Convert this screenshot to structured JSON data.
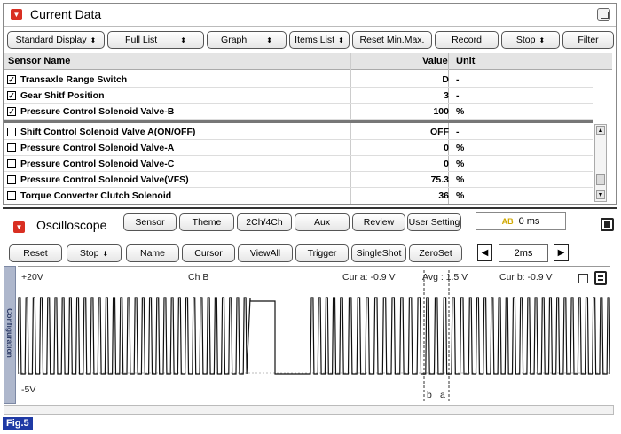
{
  "current_data": {
    "title": "Current Data",
    "toolbar": {
      "standard_display": "Standard Display",
      "full_list": "Full List",
      "graph": "Graph",
      "items_list": "Items List",
      "reset_min_max": "Reset Min.Max.",
      "record": "Record",
      "stop": "Stop",
      "filter": "Filter"
    },
    "columns": {
      "sensor_name": "Sensor Name",
      "value": "Value",
      "unit": "Unit"
    },
    "rows": [
      {
        "checked": true,
        "check_mark": "✓",
        "name": "Transaxle Range Switch",
        "value": "D",
        "unit": "-"
      },
      {
        "checked": true,
        "check_mark": "✓",
        "name": "Gear Shitf Position",
        "value": "3",
        "unit": "-"
      },
      {
        "checked": true,
        "check_mark": "✓",
        "name": "Pressure Control Solenoid Valve-B",
        "value": "100",
        "unit": "%"
      },
      {
        "checked": false,
        "check_mark": "",
        "name": "Shift Control Solenoid Valve A(ON/OFF)",
        "value": "OFF",
        "unit": "-"
      },
      {
        "checked": false,
        "check_mark": "",
        "name": "Pressure Control Solenoid Valve-A",
        "value": "0",
        "unit": "%"
      },
      {
        "checked": false,
        "check_mark": "",
        "name": "Pressure Control Solenoid Valve-C",
        "value": "0",
        "unit": "%"
      },
      {
        "checked": false,
        "check_mark": "",
        "name": "Pressure Control Solenoid Valve(VFS)",
        "value": "75.3",
        "unit": "%"
      },
      {
        "checked": false,
        "check_mark": "",
        "name": "Torque Converter Clutch Solenoid",
        "value": "36",
        "unit": "%"
      }
    ]
  },
  "oscilloscope": {
    "title": "Oscilloscope",
    "top_buttons": {
      "sensor": "Sensor",
      "theme": "Theme",
      "channels": "2Ch/4Ch",
      "aux": "Aux",
      "review": "Review",
      "user_setting": "User Setting"
    },
    "time_readout": "0 ms",
    "time_icon_text": "AB",
    "bottom_buttons": {
      "reset": "Reset",
      "stop": "Stop",
      "name": "Name",
      "cursor": "Cursor",
      "view_all": "ViewAll",
      "trigger": "Trigger",
      "single_shot": "SingleShot",
      "zero_set": "ZeroSet"
    },
    "timebase": "2ms",
    "config_tab": "Configuration",
    "plot": {
      "top_voltage": "+20V",
      "bottom_voltage": "-5V",
      "channel": "Ch B",
      "cur_a": "Cur a: -0.9 V",
      "avg": "Avg : 1.5 V",
      "cur_b": "Cur b: -0.9 V",
      "marker_b": "b",
      "marker_a": "a"
    },
    "colors": {
      "trace": "#111111",
      "cursor_line": "#333333"
    }
  },
  "figure_label": "Fig.5",
  "colors": {
    "accent_red": "#d92f22",
    "figure_label_bg": "#1f3aa5"
  }
}
